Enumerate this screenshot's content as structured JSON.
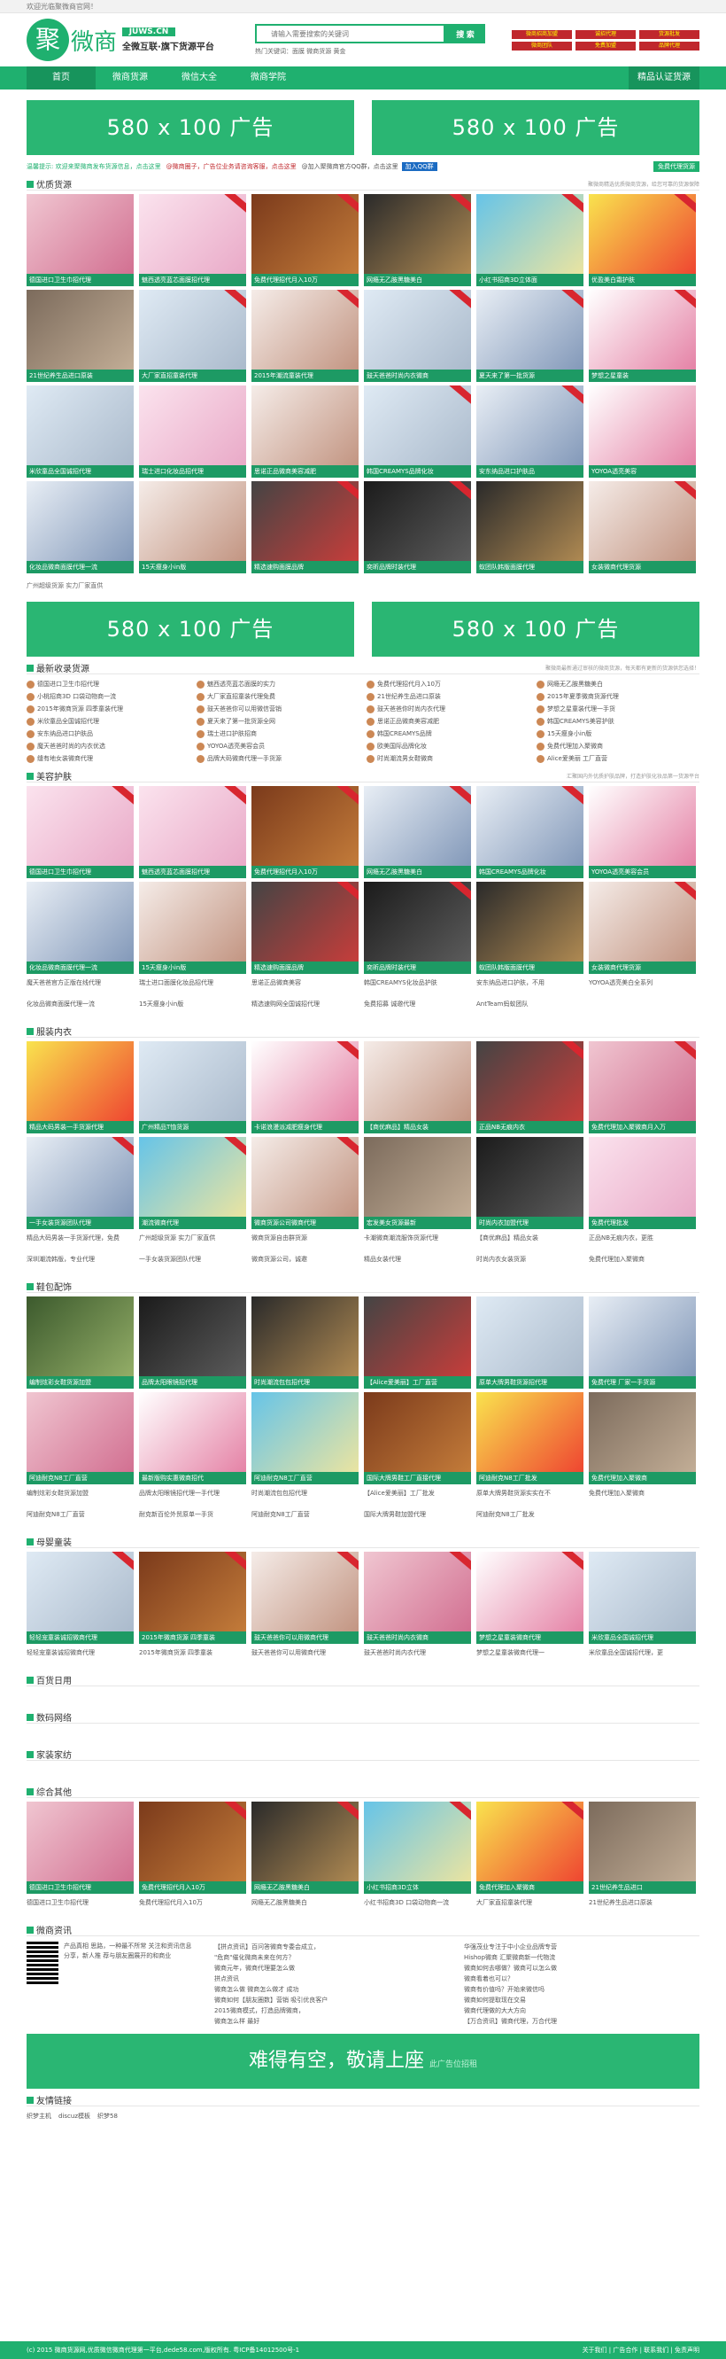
{
  "topbar": {
    "welcome": "欢迎光临聚微商官网！"
  },
  "header": {
    "logo_char": "聚",
    "logo_word": "微商",
    "domain": "JUWS.CN",
    "slogan": "全微互联·旗下货源平台",
    "search_placeholder": "请输入需要搜索的关键词",
    "search_button": "搜 索",
    "hot": "热门关键词：面膜  微商货源  黄金",
    "promo": [
      "微商招商加盟",
      "诚招代理",
      "货源批发",
      "微商团队",
      "免费加盟",
      "品牌代理"
    ]
  },
  "nav": {
    "items": [
      "首页",
      "微商货源",
      "微信大全",
      "微商学院"
    ],
    "right": "精品认证货源"
  },
  "ads": {
    "banner": "580 x 100 广告",
    "bottom": "难得有空，敬请上座",
    "bottom_small": "此广告位招租"
  },
  "notice": {
    "n1": "温馨提示: 欢迎来聚微商发布货源信息，点击这里",
    "n2": "@微商圈子，广告位业务请咨询客服，点击这里",
    "n3": "@加入聚微商官方QQ群，点击这里",
    "qq": "加入QQ群",
    "free": "免费代理货源"
  },
  "sections": {
    "quality": {
      "title": "优质货源",
      "desc": "聚微商精选优质微商货源，给您可靠的货源保障"
    },
    "latest": {
      "title": "最新收录货源",
      "desc": "聚微商最新通过审核的微商货源，每天都有更新的货源供您选择！"
    },
    "beauty": {
      "title": "美容护肤",
      "desc": "汇聚国内外优质护肤品牌，打造护肤化妆品第一货源平台"
    },
    "clothes": {
      "title": "服装内衣"
    },
    "shoes": {
      "title": "鞋包配饰"
    },
    "baby": {
      "title": "母婴童装"
    },
    "daily": {
      "title": "百货日用"
    },
    "digital": {
      "title": "数码网络"
    },
    "home": {
      "title": "家装家纺"
    },
    "other": {
      "title": "综合其他"
    },
    "info": {
      "title": "微商资讯"
    },
    "links": {
      "title": "友情链接"
    }
  },
  "quality_tiles": [
    "德国进口卫生巾招代理",
    "魅西透亮蓝芯面膜招代理",
    "免费代理招代月入10万",
    "网瘾无乙胺黑糖美白",
    "小红书招商3D立体面",
    "优盈美白霜护肤",
    "21世纪养生品进口原装",
    "大厂家直招童装代理",
    "2015年潮流童装代理",
    "鼓天爸爸时尚内衣微商",
    "夏天来了第一批货源",
    "梦想之星童装",
    "米欣童品全国诚招代理",
    "瑞士进口化妆品招代理",
    "思诺正品微商美容减肥",
    "韩国CREAMYS品牌化妆",
    "安东纳品进口护肤品",
    "YOYOA透亮美容",
    "化妆品微商面膜代理一流",
    "15天瘦身小in版",
    "精选速购面膜品牌",
    "奕昕品牌时装代理",
    "蚁团队韩版面膜代理",
    "女装微商代理货源"
  ],
  "quality_footer": "广州超级货源 实力厂家直供",
  "latest_news": [
    [
      "德国进口卫生巾招代理",
      "小桃招商3D 口袋动物商一流",
      "2015年微商货源 四季童装代理",
      "米欣童品全国诚招代理",
      "安东纳品进口护肤品",
      "魔天爸爸时尚的内衣优选",
      "缝有地女装微商代理"
    ],
    [
      "魅西透亮蓝芯面膜的实力",
      "大厂家直招童装代理免费",
      "鼓天爸爸你可以用微信营销",
      "夏天来了第一批货源全网",
      "瑞士进口护肤招商",
      "YOYOA透亮美容会员",
      "品牌大码微商代理一手货源"
    ],
    [
      "免费代理招代月入10万",
      "21世纪养生品进口原装",
      "鼓天爸爸你时尚内衣代理",
      "思诺正品微商美容减肥",
      "韩国CREAMYS品牌",
      "欧美国际品牌化妆",
      "时尚潮流男女鞋微商"
    ],
    [
      "网瘾无乙胺黑糖美白",
      "2015年夏季微商货源代理",
      "梦想之星童装代理一手货",
      "韩国CREAMYS美容护肤",
      "15天瘦身小in版",
      "免费代理加入聚微商",
      "Alice爱美丽 工厂直营"
    ]
  ],
  "beauty_tiles": [
    "德国进口卫生巾招代理",
    "魅西透亮蓝芯面膜招代理",
    "免费代理招代月入10万",
    "网瘾无乙胺黑糖美白",
    "韩国CREAMYS品牌化妆",
    "YOYOA透亮美容会员",
    "化妆品微商面膜代理一流",
    "15天瘦身小in版",
    "精选速购面膜品牌",
    "奕昕品牌时装代理",
    "蚁团队韩版面膜代理",
    "女装微商代理货源"
  ],
  "beauty_caps": [
    "魔天爸爸官方正版在线代理",
    "瑞士进口面膜化妆品招代理",
    "思诺正品微商美容",
    "韩国CREAMYS化妆品护肤",
    "安东纳品进口护肤，不用",
    "YOYOA透亮美白全系列",
    "化妆品微商面膜代理一流",
    "15天瘦身小in版",
    "精选速购网全国诚招代理",
    "免费招募 诚邀代理",
    "AntTeam蚂蚁团队",
    ""
  ],
  "clothes_tiles": [
    "精品大码男装一手货源代理",
    "广州精品T恤货源",
    "卡诺浪漫派减肥瘦身代理",
    "【商优麻品】精品女装",
    "正品NB无痕内衣",
    "免费代理加入聚微商月入万",
    "一手女装货源团队代理",
    "潮流微商代理",
    "微商货源公司微商代理",
    "宏发美女货源最新",
    "时尚内衣加盟代理",
    "免费代理批发"
  ],
  "clothes_caps": [
    "精品大码男装一手货源代理，免费",
    "广州超级货源 实力厂家直供",
    "微商货源自由群货源",
    "卡潮微商潮流服饰货源代理",
    "【商优麻品】精品女装",
    "正品NB无痕内衣，更胜",
    "深圳潮流韩版，专业代理",
    "一手女装货源团队代理",
    "微商货源公司，诚邀",
    "精品女装代理",
    "时尚内衣女装货源",
    "免费代理加入聚微商"
  ],
  "shoes_tiles": [
    "编制炫彩女鞋货源加盟",
    "品牌太阳眼镜招代理",
    "时尚潮流包包招代理",
    "【Alice爱美丽】工厂直营",
    "原单大牌男鞋货源招代理",
    "免费代理 厂家一手货源",
    "阿迪耐克N8工厂直营",
    "最新版购实惠微商招代",
    "阿迪耐克N8工厂直营",
    "国际大牌男鞋工厂直接代理",
    "阿迪耐克N8工厂批发",
    "免费代理加入聚微商"
  ],
  "shoes_caps": [
    "编制炫彩女鞋货源加盟",
    "品牌太阳眼镜招代理一手代理",
    "时尚潮流包包招代理",
    "【Alice爱美丽】工厂批发",
    "原单大牌男鞋货源实实在不",
    "免费代理加入聚微商",
    "阿迪耐克N8工厂直营",
    "耐克新百伦外贸原单一手货",
    "阿迪耐克N8工厂直营",
    "国际大牌男鞋加盟代理",
    "阿迪耐克N8工厂批发",
    ""
  ],
  "baby_tiles": [
    "轻轻宠童装诚招微商代理",
    "2015年微商货源 四季童装",
    "鼓天爸爸你可以用微商代理",
    "鼓天爸爸时尚内衣微商",
    "梦想之星童装微商代理",
    "米欣童品全国诚招代理"
  ],
  "baby_caps": [
    "轻轻宠童装诚招微商代理",
    "2015年微商货源 四季童装",
    "鼓天爸爸你可以用微商代理",
    "鼓天爸爸时尚内衣代理",
    "梦想之星童装微商代理一",
    "米欣童品全国诚招代理，更"
  ],
  "other_tiles": [
    "德国进口卫生巾招代理",
    "免费代理招代月入10万",
    "网瘾无乙胺黑糖美白",
    "小红书招商3D立体",
    "免费代理加入聚微商",
    "21世纪养生品进口"
  ],
  "other_caps": [
    "德国进口卫生巾招代理",
    "免费代理招代月入10万",
    "网瘾无乙胺黑糖美白",
    "小红书招商3D 口袋动物商一流",
    "大厂家直招童装代理",
    "21世纪养生品进口原装"
  ],
  "info": {
    "qr_text": "产品真相 思路，一种最不所常 关注和资讯信息分享，新人推 荐与朋友圈展开的和商业",
    "news": [
      "【拼点资讯】百问答微商专委会成立，",
      "\"危商\"催化微商未来在何方？",
      "微商元年，微商代理要怎么做",
      "拼点资讯",
      "微商怎么做 微商怎么做才 成功",
      "微商如何【朋友圈数】营销 吸引优良客户",
      "2015微商模式，打造品牌微商，",
      "微商怎么样 最好",
      "华强茂业专注于中小企业品牌专营",
      "Hishop微商 汇聚微商新一代物流",
      "微商如何去哪做？微商可以怎么做",
      "微商看着也可以？",
      "微商有价值吗？开始来微信吗",
      "微商如何提取现在交易",
      "微商代理做的大大方向",
      "【万合资讯】微商代理，万合代理"
    ]
  },
  "links": [
    "织梦主机",
    "discuz模板",
    "织梦58"
  ],
  "footer": {
    "left": "(c) 2015 微商货源网,优质微信微商代理第一平台,dede58.com,版权所有. 粤ICP备14012500号-1",
    "right": "关于我们 | 广告合作 | 联系我们 | 免责声明"
  }
}
